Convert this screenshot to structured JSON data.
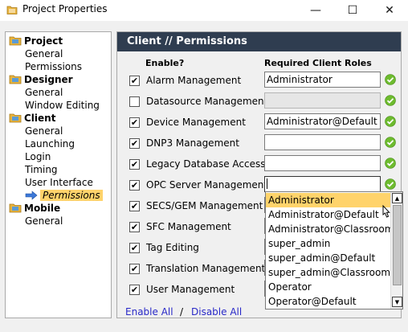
{
  "window": {
    "title": "Project Properties",
    "minimize": "—",
    "maximize": "☐",
    "close": "✕"
  },
  "tree": {
    "categories": [
      {
        "label": "Project",
        "items": [
          "General",
          "Permissions"
        ]
      },
      {
        "label": "Designer",
        "items": [
          "General",
          "Window Editing"
        ]
      },
      {
        "label": "Client",
        "items": [
          "General",
          "Launching",
          "Login",
          "Timing",
          "User Interface",
          "Permissions"
        ]
      },
      {
        "label": "Mobile",
        "items": [
          "General"
        ]
      }
    ],
    "selected": "Client / Permissions"
  },
  "panel": {
    "title": "Client // Permissions",
    "col_enable": "Enable?",
    "col_roles": "Required Client Roles",
    "rows": [
      {
        "label": "Alarm Management",
        "checked": true,
        "roles": "Administrator"
      },
      {
        "label": "Datasource Management",
        "checked": false,
        "roles": ""
      },
      {
        "label": "Device Management",
        "checked": true,
        "roles": "Administrator@Default"
      },
      {
        "label": "DNP3 Management",
        "checked": true,
        "roles": ""
      },
      {
        "label": "Legacy Database Access",
        "checked": true,
        "roles": ""
      },
      {
        "label": "OPC Server Management",
        "checked": true,
        "roles": ""
      },
      {
        "label": "SECS/GEM Management",
        "checked": true,
        "roles": ""
      },
      {
        "label": "SFC Management",
        "checked": true,
        "roles": ""
      },
      {
        "label": "Tag Editing",
        "checked": true,
        "roles": ""
      },
      {
        "label": "Translation Management",
        "checked": true,
        "roles": ""
      },
      {
        "label": "User Management",
        "checked": true,
        "roles": ""
      }
    ],
    "enable_all": "Enable All",
    "separator": "/",
    "disable_all": "Disable All"
  },
  "dropdown": {
    "options": [
      "Administrator",
      "Administrator@Default",
      "Administrator@Classroom",
      "super_admin",
      "super_admin@Default",
      "super_admin@Classroom",
      "Operator",
      "Operator@Default"
    ],
    "highlighted": "Administrator"
  },
  "colors": {
    "header_bg": "#2f3d50",
    "selection": "#ffd36b",
    "link": "#2929c8",
    "ok_green": "#6dbb2e"
  }
}
